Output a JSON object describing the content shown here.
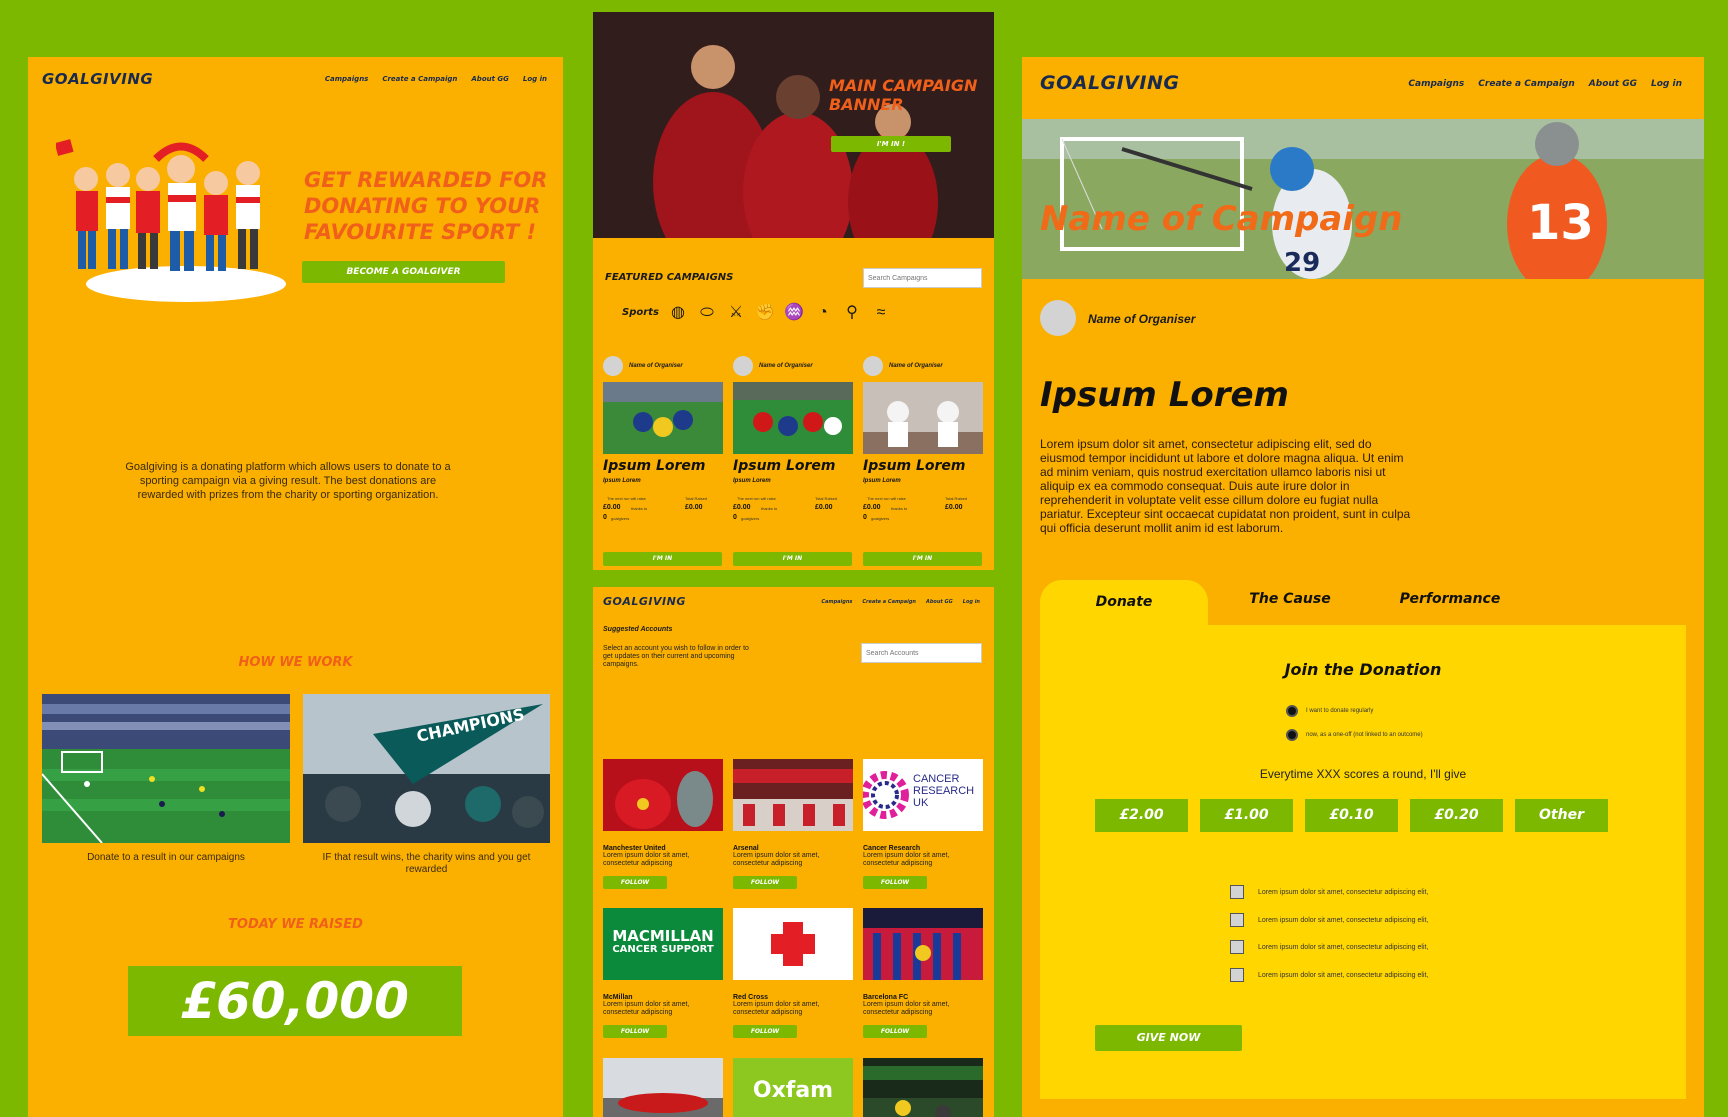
{
  "landing": {
    "brand": "GOALGIVING",
    "nav": [
      "Campaigns",
      "Create a Campaign",
      "About GG",
      "Log in"
    ],
    "hero_title": "GET REWARDED FOR DONATING TO YOUR FAVOURITE SPORT !",
    "hero_button": "BECOME A GOALGIVER",
    "about": "Goalgiving is a donating platform which allows users to donate to a sporting campaign via a giving result. The best donations are rewarded with prizes from the charity or sporting organization.",
    "how_heading": "HOW WE WORK",
    "how_caption_1": "Donate to a result in our campaigns",
    "how_caption_2": "IF that result wins, the charity wins and you get rewarded",
    "pennant_text": "CHAMPIONS",
    "raised_heading": "TODAY WE RAISED",
    "raised_amount": "£60,000"
  },
  "campaigns": {
    "banner_title": "MAIN CAMPAIGN BANNER",
    "banner_button": "I'M IN !",
    "featured_heading": "FEATURED CAMPAIGNS",
    "search_placeholder": "Search Campaigns",
    "sports_label": "Sports",
    "sports_icons": [
      "volleyball-icon",
      "rugby-ball-icon",
      "cricket-icon",
      "boxing-glove-icon",
      "swimmer-icon",
      "ball-icon",
      "cyclist-icon",
      "swimming-icon"
    ],
    "cards": [
      {
        "organiser": "Name of Organiser",
        "title": "Ipsum Lorem",
        "subtitle": "Ipsum Lorem",
        "meta_left": "The next run will raise",
        "meta_right": "Total Raised",
        "amount": "£0.00",
        "thanks": "thanks to",
        "total": "£0.00",
        "givers": "0",
        "givers_label": "goalgivers",
        "button": "I'M IN"
      },
      {
        "organiser": "Name of Organiser",
        "title": "Ipsum Lorem",
        "subtitle": "Ipsum Lorem",
        "meta_left": "The next run will raise",
        "meta_right": "Total Raised",
        "amount": "£0.00",
        "thanks": "thanks to",
        "total": "£0.00",
        "givers": "0",
        "givers_label": "goalgivers",
        "button": "I'M IN"
      },
      {
        "organiser": "Name of Organiser",
        "title": "Ipsum Lorem",
        "subtitle": "Ipsum Lorem",
        "meta_left": "The next run will raise",
        "meta_right": "Total Raised",
        "amount": "£0.00",
        "thanks": "thanks to",
        "total": "£0.00",
        "givers": "0",
        "givers_label": "goalgivers",
        "button": "I'M IN"
      }
    ]
  },
  "accounts": {
    "brand": "GOALGIVING",
    "nav": [
      "Campaigns",
      "Create a Campaign",
      "About GG",
      "Log in"
    ],
    "heading": "Suggested Accounts",
    "text": "Select an account you wish to follow in order to get updates on their current and upcoming campaigns.",
    "search_placeholder": "Search Accounts",
    "items": [
      {
        "name": "Manchester United",
        "desc": "Lorem ipsum dolor sit amet, consectetur adipiscing",
        "button": "FOLLOW"
      },
      {
        "name": "Arsenal",
        "desc": "Lorem ipsum dolor sit amet, consectetur adipiscing",
        "button": "FOLLOW"
      },
      {
        "name": "Cancer Research",
        "desc": "Lorem ipsum dolor sit amet, consectetur adipiscing",
        "button": "FOLLOW",
        "logo_text": [
          "CANCER",
          "RESEARCH",
          "UK"
        ]
      },
      {
        "name": "McMillan",
        "desc": "Lorem ipsum dolor sit amet, consectetur adipiscing",
        "button": "FOLLOW",
        "logo_text": [
          "MACMILLAN",
          "CANCER SUPPORT"
        ]
      },
      {
        "name": "Red Cross",
        "desc": "Lorem ipsum dolor sit amet, consectetur adipiscing",
        "button": "FOLLOW"
      },
      {
        "name": "Barcelona FC",
        "desc": "Lorem ipsum dolor sit amet, consectetur adipiscing",
        "button": "FOLLOW"
      }
    ],
    "oxfam_logo": "Oxfam"
  },
  "campaign_page": {
    "brand": "GOALGIVING",
    "nav": [
      "Campaigns",
      "Create a Campaign",
      "About GG",
      "Log in"
    ],
    "campaign_name": "Name of Campaign",
    "jersey_numbers": [
      "29",
      "13"
    ],
    "organiser": "Name of Organiser",
    "title": "Ipsum Lorem",
    "description": "Lorem ipsum dolor sit amet, consectetur adipiscing elit, sed do eiusmod tempor incididunt ut labore et dolore magna aliqua. Ut enim ad minim veniam, quis nostrud exercitation ullamco laboris nisi ut aliquip ex ea commodo consequat. Duis aute irure dolor in reprehenderit in voluptate velit esse cillum dolore eu fugiat nulla pariatur. Excepteur sint occaecat cupidatat non proident, sunt in culpa qui officia deserunt mollit anim id est laborum.",
    "tabs": [
      "Donate",
      "The Cause",
      "Performance"
    ],
    "join_heading": "Join the Donation",
    "radio_1": "I want to donate regularly",
    "radio_2": "now, as a one-off (not linked to an outcome)",
    "everytime": "Everytime XXX scores a round, I'll give",
    "amounts": [
      "£2.00",
      "£1.00",
      "£0.10",
      "£0.20",
      "Other"
    ],
    "checks": [
      "Lorem ipsum dolor sit amet, consectetur adipiscing elit,",
      "Lorem ipsum dolor sit amet, consectetur adipiscing elit,",
      "Lorem ipsum dolor sit amet, consectetur adipiscing elit,",
      "Lorem ipsum dolor sit amet, consectetur adipiscing elit,"
    ],
    "give_button": "GIVE NOW"
  },
  "colors": {
    "background": "#7cb800",
    "panel": "#fbb000",
    "accent_green": "#7cb800",
    "accent_orange": "#f0601a",
    "tab_yellow": "#ffd600"
  }
}
